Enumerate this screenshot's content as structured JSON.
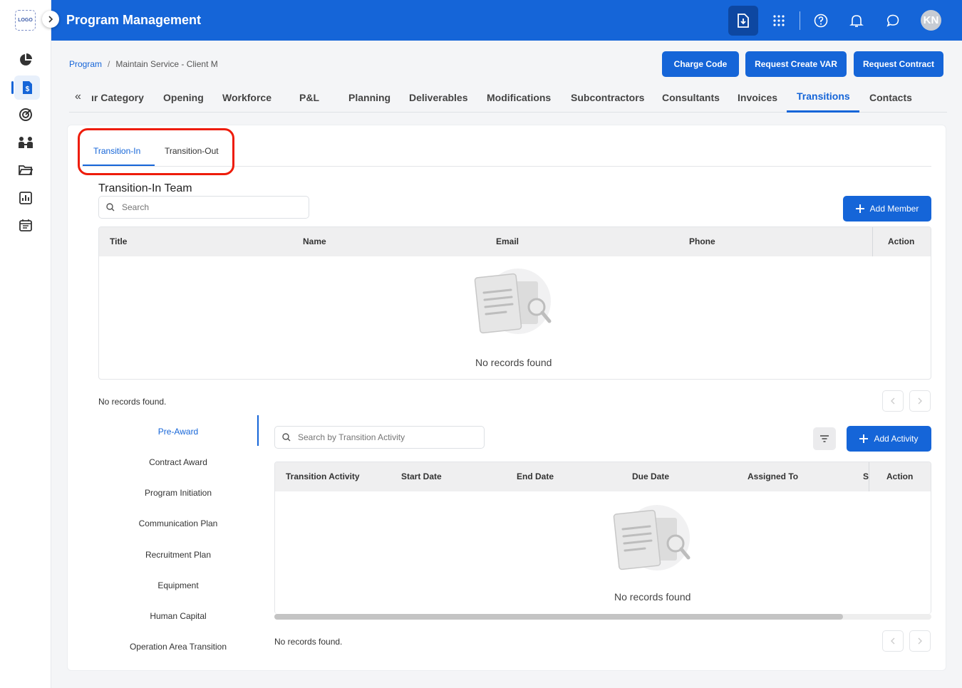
{
  "app": {
    "title": "Program Management",
    "logo_text": "LOGO",
    "avatar_initials": "KN"
  },
  "breadcrumb": {
    "root": "Program",
    "separator": "/",
    "current": "Maintain Service - Client M"
  },
  "top_buttons": {
    "charge_code": "Charge Code",
    "request_create_var": "Request Create VAR",
    "request_contract": "Request Contract"
  },
  "main_tabs": [
    {
      "label": "ır Category"
    },
    {
      "label": "Opening"
    },
    {
      "label": "Workforce"
    },
    {
      "label": "P&L"
    },
    {
      "label": "Planning"
    },
    {
      "label": "Deliverables"
    },
    {
      "label": "Modifications"
    },
    {
      "label": "Subcontractors"
    },
    {
      "label": "Consultants"
    },
    {
      "label": "Invoices"
    },
    {
      "label": "Transitions"
    },
    {
      "label": "Contacts"
    }
  ],
  "sub_tabs": {
    "transition_in": "Transition-In",
    "transition_out": "Transition-Out"
  },
  "team": {
    "title": "Transition-In Team",
    "search_placeholder": "Search",
    "add_button": "Add Member",
    "columns": [
      "Title",
      "Name",
      "Email",
      "Phone",
      "Action"
    ],
    "empty_text": "No records found",
    "footer_text": "No records found."
  },
  "activities": {
    "nav": [
      "Pre-Award",
      "Contract Award",
      "Program Initiation",
      "Communication Plan",
      "Recruitment Plan",
      "Equipment",
      "Human Capital",
      "Operation Area Transition"
    ],
    "active_nav": "Pre-Award",
    "search_placeholder": "Search by Transition Activity",
    "add_button": "Add Activity",
    "columns": [
      "Transition Activity",
      "Start Date",
      "End Date",
      "Due Date",
      "Assigned To",
      "S",
      "Action"
    ],
    "empty_text": "No records found",
    "footer_text": "No records found."
  },
  "colors": {
    "primary": "#1565d8",
    "highlight": "#ee1c0a"
  }
}
